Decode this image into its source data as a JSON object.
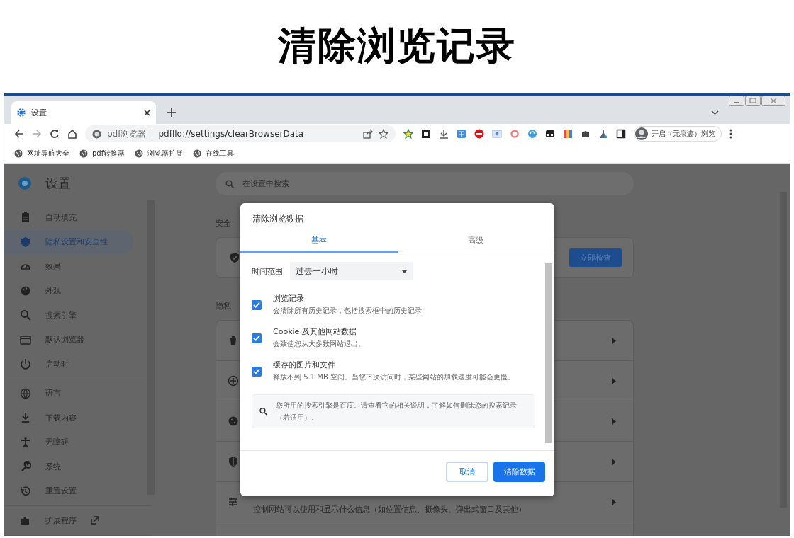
{
  "heading": "清除浏览记录",
  "browser": {
    "tabs": [
      {
        "title": "设置",
        "selected": true
      }
    ],
    "address": {
      "site_label": "pdf浏览器",
      "url": "pdfllq://settings/clearBrowserData"
    },
    "profile_button": "开启（无痕迹）浏览",
    "bookmarks": [
      "网址导航大全",
      "pdf转换器",
      "浏览器扩展",
      "在线工具"
    ]
  },
  "settings": {
    "title": "设置",
    "search_placeholder": "在设置中搜索",
    "sidebar_groups": [
      [
        {
          "label": "自动填充",
          "selected": false
        },
        {
          "label": "隐私设置和安全性",
          "selected": true
        },
        {
          "label": "效果",
          "selected": false
        },
        {
          "label": "外观",
          "selected": false
        },
        {
          "label": "搜索引擎",
          "selected": false
        },
        {
          "label": "默认浏览器",
          "selected": false
        },
        {
          "label": "启动时",
          "selected": false
        }
      ],
      [
        {
          "label": "语言",
          "selected": false
        },
        {
          "label": "下载内容",
          "selected": false
        },
        {
          "label": "无障碍",
          "selected": false
        },
        {
          "label": "系统",
          "selected": false
        },
        {
          "label": "重置设置",
          "selected": false
        }
      ],
      [
        {
          "label": "扩展程序",
          "selected": false
        }
      ]
    ],
    "safety_heading": "安全",
    "safety_button": "立即检查",
    "privacy_heading": "隐私",
    "privacy_rows": [
      {
        "kind": "plain"
      },
      {
        "kind": "plain"
      },
      {
        "kind": "plain"
      },
      {
        "kind": "plain"
      },
      {
        "kind": "described",
        "description": "控制网站可以使用和显示什么信息（如位置信息、摄像头、弹出式窗口及其他）"
      }
    ]
  },
  "dialog": {
    "title": "清除浏览数据",
    "tabs": [
      {
        "label": "基本",
        "selected": true
      },
      {
        "label": "高级",
        "selected": false
      }
    ],
    "time_range_label": "时间范围",
    "time_range_value": "过去一小时",
    "options": [
      {
        "title": "浏览记录",
        "description": "会清除所有历史记录，包括搜索框中的历史记录",
        "checked": true
      },
      {
        "title": "Cookie 及其他网站数据",
        "description": "会致使您从大多数网站退出。",
        "checked": true
      },
      {
        "title": "缓存的图片和文件",
        "description": "释放不到 5.1 MB 空间。当您下次访问时，某些网站的加载速度可能会更慢。",
        "checked": true
      }
    ],
    "notice": "您所用的搜索引擎是百度。请查看它的相关说明，了解如何删除您的搜索记录（若适用）。",
    "buttons": [
      {
        "label": "取消",
        "kind": "secondary"
      },
      {
        "label": "清除数据",
        "kind": "primary"
      }
    ]
  }
}
